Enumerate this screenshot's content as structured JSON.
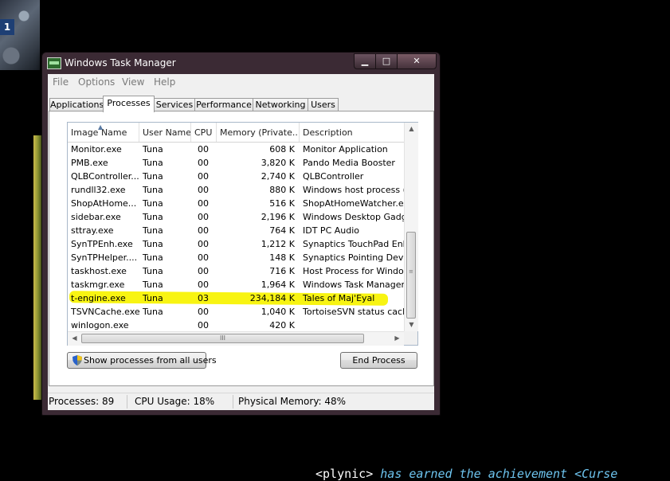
{
  "background": {
    "badge_number": "1",
    "chat": {
      "user": "<plynic>",
      "text": "has earned the achievement <Curse"
    }
  },
  "window": {
    "title": "Windows Task Manager",
    "controls": {
      "minimize": "▁",
      "maximize": "□",
      "close": "✕"
    },
    "menu": [
      "File",
      "Options",
      "View",
      "Help"
    ],
    "tabs": [
      "Applications",
      "Processes",
      "Services",
      "Performance",
      "Networking",
      "Users"
    ],
    "active_tab": "Processes"
  },
  "process_list": {
    "columns": [
      "Image Name",
      "User Name",
      "CPU",
      "Memory (Private...",
      "Description"
    ],
    "sorted_column": "Image Name",
    "rows": [
      [
        "Monitor.exe",
        "Tuna",
        "00",
        "608 K",
        "Monitor Application"
      ],
      [
        "PMB.exe",
        "Tuna",
        "00",
        "3,820 K",
        "Pando Media Booster"
      ],
      [
        "QLBController...",
        "Tuna",
        "00",
        "2,740 K",
        "QLBController"
      ],
      [
        "rundll32.exe",
        "Tuna",
        "00",
        "880 K",
        "Windows host process (Ru"
      ],
      [
        "ShopAtHome...",
        "Tuna",
        "00",
        "516 K",
        "ShopAtHomeWatcher.exe"
      ],
      [
        "sidebar.exe",
        "Tuna",
        "00",
        "2,196 K",
        "Windows Desktop Gadgets"
      ],
      [
        "sttray.exe",
        "Tuna",
        "00",
        "764 K",
        "IDT PC Audio"
      ],
      [
        "SynTPEnh.exe",
        "Tuna",
        "00",
        "1,212 K",
        "Synaptics TouchPad Enhar"
      ],
      [
        "SynTPHelper....",
        "Tuna",
        "00",
        "148 K",
        "Synaptics Pointing Device"
      ],
      [
        "taskhost.exe",
        "Tuna",
        "00",
        "716 K",
        "Host Process for Windows"
      ],
      [
        "taskmgr.exe",
        "Tuna",
        "00",
        "1,964 K",
        "Windows Task Manager"
      ],
      [
        "t-engine.exe",
        "Tuna",
        "03",
        "234,184 K",
        "Tales of Maj'Eyal"
      ],
      [
        "TSVNCache.exe",
        "Tuna",
        "00",
        "1,040 K",
        "TortoiseSVN status cache"
      ],
      [
        "winlogon.exe",
        "",
        "00",
        "420 K",
        ""
      ]
    ],
    "highlighted_row": "t-engine.exe",
    "highlight_color": "#f8f412",
    "h_scroll_grip": "III"
  },
  "buttons": {
    "show_all": "Show processes from all users",
    "end_process": "End Process"
  },
  "status": {
    "processes": "Processes: 89",
    "cpu": "CPU Usage: 18%",
    "memory": "Physical Memory: 48%"
  }
}
